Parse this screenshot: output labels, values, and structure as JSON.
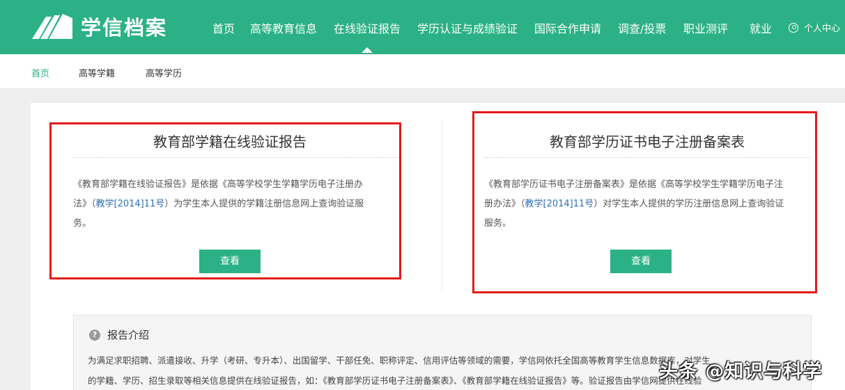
{
  "header": {
    "logo_text": "学信档案",
    "nav": [
      {
        "label": "首页"
      },
      {
        "label": "高等教育信息"
      },
      {
        "label": "在线验证报告"
      },
      {
        "label": "学历认证与成绩验证"
      },
      {
        "label": "国际合作申请"
      },
      {
        "label": "调查/投票"
      },
      {
        "label": "职业测评"
      },
      {
        "label": "就业"
      }
    ],
    "active_nav": "在线验证报告",
    "user_label": "个人中心"
  },
  "breadcrumb": [
    "首页",
    "高等学籍",
    "高等学历"
  ],
  "cards": [
    {
      "title": "教育部学籍在线验证报告",
      "desc_line1": "《教育部学籍在线验证报告》是依据《高等学校学生学籍学历电子注册办",
      "desc_line2_pre": "法》（",
      "desc_link": "教学[2014]11号",
      "desc_line2_post": "）为学生本人提供的学籍注册信息网上查询验证服",
      "desc_line3": "务。",
      "button": "查看"
    },
    {
      "title": "教育部学历证书电子注册备案表",
      "desc_line1": "《教育部学历证书电子注册备案表》是依据《高等学校学生学籍学历电子注",
      "desc_line2_pre": "册办法》（",
      "desc_link": "教学[2014]11号",
      "desc_line2_post": "）对学生本人提供的学历注册信息网上查询验证",
      "desc_line3": "服务。",
      "button": "查看"
    }
  ],
  "intro": {
    "title": "报告介绍",
    "line1": "为满足求职招聘、派遣接收、升学（考研、专升本）、出国留学、干部任免、职称评定、信用评估等领域的需要，学信网依托全国高等教育学生信息数据库，对学生",
    "line2": "的学籍、学历、招生录取等相关信息提供在线验证报告，如：《教育部学历证书电子注册备案表》、《教育部学籍在线验证报告》等。验证报告由学信网提供在线验"
  },
  "watermark": "头条 @知识与科学",
  "colors": {
    "brand": "#2bb185",
    "highlight_box": "#e11b1b",
    "link": "#2f6fb6"
  }
}
